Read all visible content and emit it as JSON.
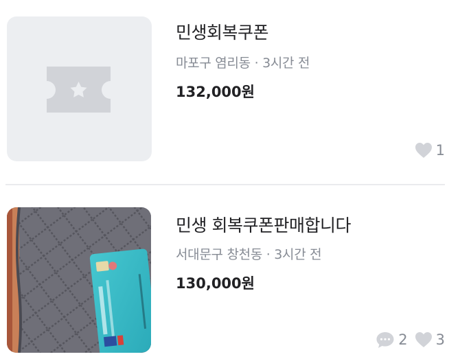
{
  "items": [
    {
      "title": "민생회복쿠폰",
      "location": "마포구 염리동",
      "separator": "·",
      "time": "3시간 전",
      "price": "132,000원",
      "thumbnail_icon": "ticket-placeholder-icon",
      "likes": "1"
    },
    {
      "title": "민생 회복쿠폰판매합니다",
      "location": "서대문구 창천동",
      "separator": "·",
      "time": "3시간 전",
      "price": "130,000원",
      "thumbnail_icon": "photo",
      "chats": "2",
      "likes": "3"
    }
  ],
  "colors": {
    "text_primary": "#212124",
    "text_secondary": "#868b94",
    "icon_gray": "#d1d3d8",
    "placeholder_bg": "#eceef1",
    "divider": "#eaebee"
  }
}
